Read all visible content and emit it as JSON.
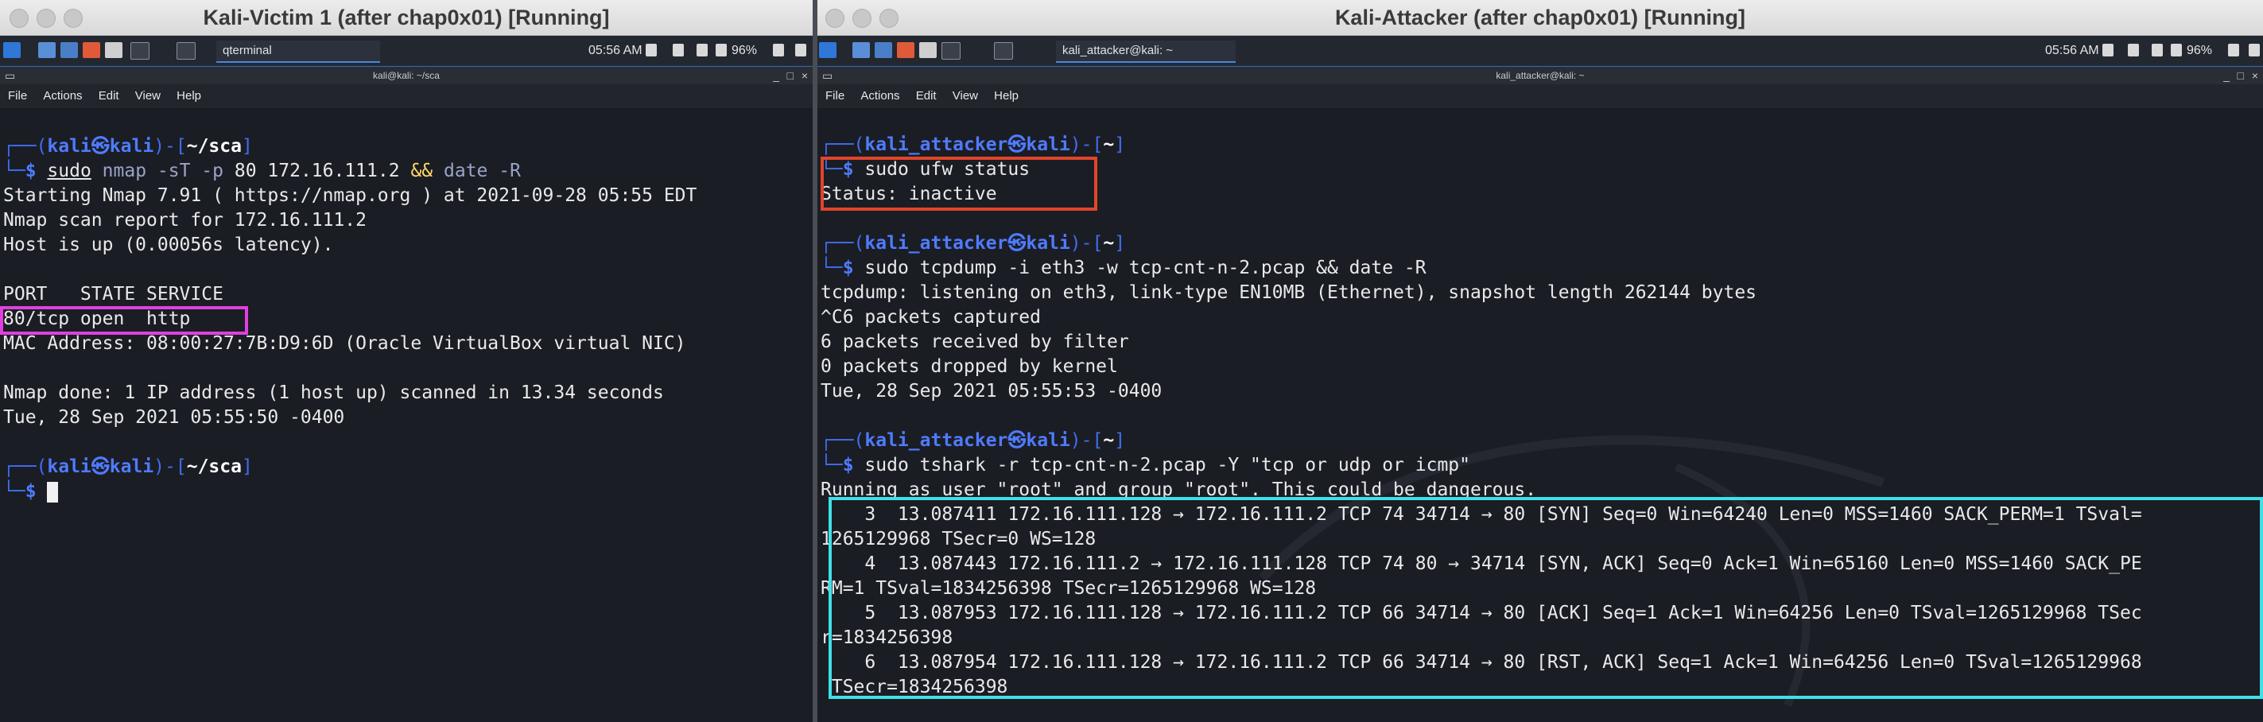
{
  "left_vm": {
    "window_title": "Kali-Victim 1 (after chap0x01) [Running]",
    "panel": {
      "task_label": "qterminal",
      "clock": "05:56 AM",
      "battery": "96%"
    },
    "terminal_title": "kali@kali: ~/sca",
    "menu": [
      "File",
      "Actions",
      "Edit",
      "View",
      "Help"
    ],
    "prompt": {
      "user": "kali",
      "host": "kali",
      "dir": "~/sca"
    },
    "cmd": {
      "sudo": "sudo",
      "bin": "nmap",
      "opts": "-sT -p",
      "args": "80 172.16.111.2",
      "op": "&&",
      "tail": "date",
      "tail_opt": "-R"
    },
    "output": [
      "Starting Nmap 7.91 ( https://nmap.org ) at 2021-09-28 05:55 EDT",
      "Nmap scan report for 172.16.111.2",
      "Host is up (0.00056s latency).",
      "",
      "PORT   STATE SERVICE",
      "80/tcp open  http",
      "MAC Address: 08:00:27:7B:D9:6D (Oracle VirtualBox virtual NIC)",
      "",
      "Nmap done: 1 IP address (1 host up) scanned in 13.34 seconds",
      "Tue, 28 Sep 2021 05:55:50 -0400"
    ],
    "highlight_color": "#e040e0"
  },
  "right_vm": {
    "window_title": "Kali-Attacker (after chap0x01) [Running]",
    "panel": {
      "task_label": "kali_attacker@kali: ~",
      "clock": "05:56 AM",
      "battery": "96%"
    },
    "terminal_title": "kali_attacker@kali: ~",
    "menu": [
      "File",
      "Actions",
      "Edit",
      "View",
      "Help"
    ],
    "prompt": {
      "user": "kali_attacker",
      "host": "kali",
      "dir": "~"
    },
    "cmd1": "sudo ufw status",
    "out1": [
      "Status: inactive"
    ],
    "cmd2": "sudo tcpdump -i eth3 -w tcp-cnt-n-2.pcap && date -R",
    "out2": [
      "tcpdump: listening on eth3, link-type EN10MB (Ethernet), snapshot length 262144 bytes",
      "^C6 packets captured",
      "6 packets received by filter",
      "0 packets dropped by kernel",
      "Tue, 28 Sep 2021 05:55:53 -0400"
    ],
    "cmd3": "sudo tshark -r tcp-cnt-n-2.pcap -Y \"tcp or udp or icmp\"",
    "out3": [
      "Running as user \"root\" and group \"root\". This could be dangerous.",
      "    3  13.087411 172.16.111.128 → 172.16.111.2 TCP 74 34714 → 80 [SYN] Seq=0 Win=64240 Len=0 MSS=1460 SACK_PERM=1 TSval=",
      "1265129968 TSecr=0 WS=128",
      "    4  13.087443 172.16.111.2 → 172.16.111.128 TCP 74 80 → 34714 [SYN, ACK] Seq=0 Ack=1 Win=65160 Len=0 MSS=1460 SACK_PE",
      "RM=1 TSval=1834256398 TSecr=1265129968 WS=128",
      "    5  13.087953 172.16.111.128 → 172.16.111.2 TCP 66 34714 → 80 [ACK] Seq=1 Ack=1 Win=64256 Len=0 TSval=1265129968 TSec",
      "r=1834256398",
      "    6  13.087954 172.16.111.128 → 172.16.111.2 TCP 66 34714 → 80 [RST, ACK] Seq=1 Ack=1 Win=64256 Len=0 TSval=1265129968",
      " TSecr=1834256398"
    ],
    "highlight_red": "#e0452b",
    "highlight_cyan": "#3fe0e8"
  }
}
